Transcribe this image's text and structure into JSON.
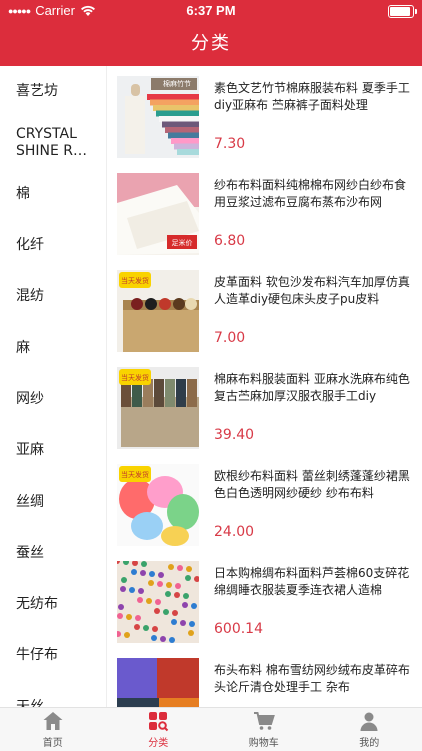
{
  "status_bar": {
    "carrier": "Carrier",
    "time": "6:37 PM",
    "battery_level": 1.0
  },
  "header": {
    "title": "分类"
  },
  "categories": [
    {
      "label": "喜艺坊"
    },
    {
      "label": "CRYSTAL SHINE R…"
    },
    {
      "label": "棉"
    },
    {
      "label": "化纤"
    },
    {
      "label": "混纺"
    },
    {
      "label": "麻"
    },
    {
      "label": "网纱"
    },
    {
      "label": "亚麻"
    },
    {
      "label": "丝绸"
    },
    {
      "label": "蚕丝"
    },
    {
      "label": "无纺布"
    },
    {
      "label": "牛仔布"
    },
    {
      "label": "天丝"
    }
  ],
  "products": [
    {
      "title": "素色文艺竹节棉麻服装布料 夏季手工diy亚麻布 苎麻裤子面料处理",
      "price": "7.30",
      "image_text": "棉麻竹节"
    },
    {
      "title": "纱布布料面料纯棉棉布网纱白纱布食用豆浆过滤布豆腐布蒸布沙布网",
      "price": "6.80",
      "image_text": "足米价"
    },
    {
      "title": "皮革面料 软包沙发布料汽车加厚仿真人造革diy硬包床头皮子pu皮料",
      "price": "7.00",
      "image_text": "当天发货"
    },
    {
      "title": "棉麻布料服装面料 亚麻水洗麻布纯色复古苎麻加厚汉服衣服手工diy",
      "price": "39.40",
      "image_text": "当天发货"
    },
    {
      "title": "欧根纱布料面料 蕾丝刺绣蓬蓬纱裙黑色白色透明网纱硬纱 纱布布料",
      "price": "24.00",
      "image_text": "当天发货"
    },
    {
      "title": "日本购棉绸布料面料芦荟棉60支碎花绵绸睡衣服装夏季连衣裙人造棉",
      "price": "600.14",
      "image_text": ""
    },
    {
      "title": "布头布料 棉布雪纺网纱绒布皮革碎布头论斤清仓处理手工 杂布",
      "price": "",
      "image_text": ""
    }
  ],
  "tabbar": {
    "items": [
      {
        "label": "首页",
        "icon": "home-icon",
        "active": false
      },
      {
        "label": "分类",
        "icon": "category-icon",
        "active": true
      },
      {
        "label": "购物车",
        "icon": "cart-icon",
        "active": false
      },
      {
        "label": "我的",
        "icon": "person-icon",
        "active": false
      }
    ]
  },
  "colors": {
    "brand": "#dc2d3c",
    "price": "#d83a47",
    "tab_active": "#dc2d3c",
    "tab_inactive": "#8a8a8a"
  }
}
